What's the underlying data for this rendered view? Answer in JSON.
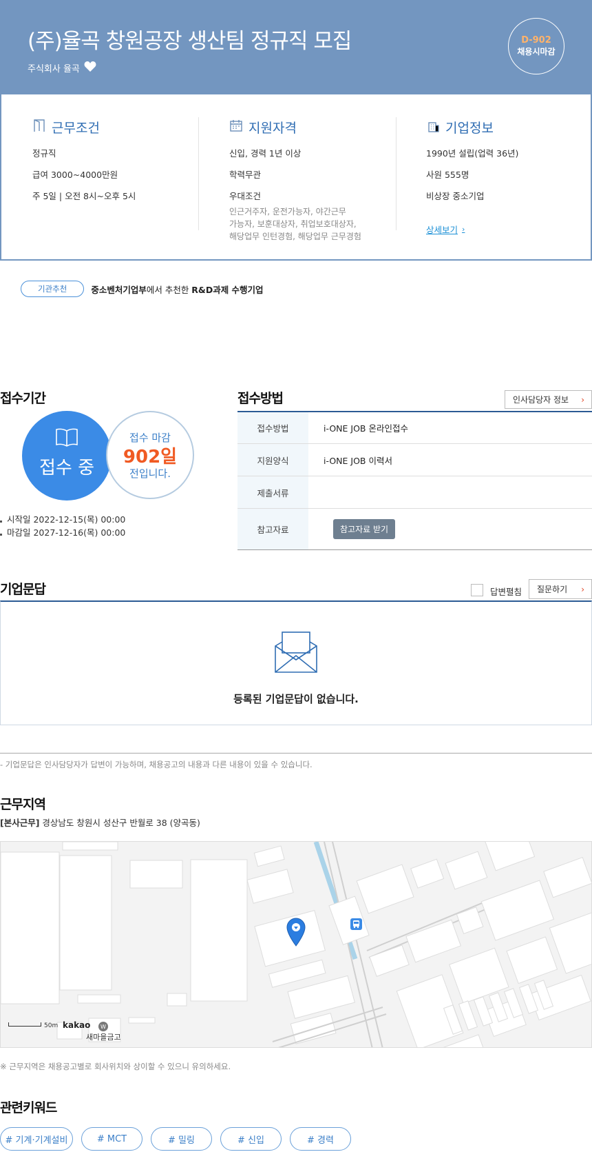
{
  "header": {
    "title": "(주)율곡 창원공장 생산팀 정규직 모집",
    "company": "주식회사 율곡",
    "dday": "D-902",
    "dday_text": "채용시마감"
  },
  "summary": {
    "work": {
      "title": "근무조건",
      "lines": [
        "정규직",
        "급여 3000~4000만원",
        "주 5일 | 오전 8시~오후 5시"
      ]
    },
    "qualify": {
      "title": "지원자격",
      "lines": [
        "신입, 경력 1년 이상",
        "학력무관",
        "우대조건"
      ],
      "preferred": [
        "인근거주자, 운전가능자, 야간근무",
        "가능자, 보훈대상자, 취업보호대상자,",
        "해당업무 인턴경험, 해당업무 근무경험"
      ]
    },
    "company": {
      "title": "기업정보",
      "lines": [
        "1990년 설립(업력 36년)",
        "사원 555명",
        "비상장 중소기업"
      ],
      "more": "상세보기"
    }
  },
  "recommend": {
    "pill": "기관추천",
    "org": "중소벤처기업부",
    "mid": "에서 추천한 ",
    "tag": "R&D과제 수행기업"
  },
  "period": {
    "title": "접수기간",
    "status": "접수 중",
    "close_label": "접수 마감",
    "days": "902일",
    "before": "전입니다.",
    "start": "시작일 2022-12-15(목) 00:00",
    "end": "마감일 2027-12-16(목) 00:00"
  },
  "method": {
    "title": "접수방법",
    "hr_button": "인사담당자 정보",
    "rows": [
      {
        "label": "접수방법",
        "value": "i-ONE JOB 온라인접수"
      },
      {
        "label": "지원양식",
        "value": "i-ONE JOB 이력서"
      },
      {
        "label": "제출서류",
        "value": ""
      },
      {
        "label": "참고자료",
        "value": ""
      }
    ],
    "ref_button": "참고자료 받기"
  },
  "qa": {
    "title": "기업문답",
    "toggle_label": "답변펼침",
    "ask_button": "질문하기",
    "empty": "등록된 기업문답이 없습니다.",
    "note": "- 기업문답은 인사담당자가 답변이 가능하며, 채용공고의 내용과 다른 내용이 있을 수 있습니다."
  },
  "location": {
    "title": "근무지역",
    "tag": "[본사근무]",
    "address": " 경상남도 창원시 성산구 반월로 38 (양곡동)",
    "scale": "50m",
    "map_logo": "kakao",
    "poi": "새마을금고",
    "note": "※ 근무지역은 채용공고별로 회사위치와 상이할 수 있으니 유의하세요."
  },
  "keywords": {
    "title": "관련키워드",
    "items": [
      "# 기계·기계설비",
      "# MCT",
      "# 밀링",
      "# 신입",
      "# 경력"
    ]
  },
  "colors": {
    "header_bg": "#7396c0",
    "accent_blue": "#3b8be6",
    "accent_orange": "#f05a23"
  }
}
